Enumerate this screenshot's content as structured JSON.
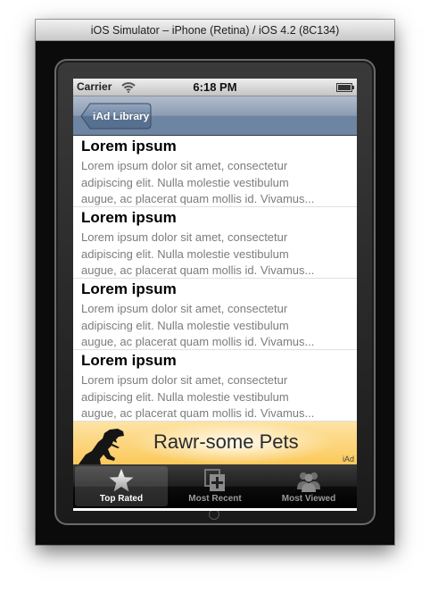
{
  "window": {
    "title": "iOS Simulator – iPhone (Retina) / iOS 4.2 (8C134)"
  },
  "status_bar": {
    "carrier": "Carrier",
    "time": "6:18 PM",
    "icons": [
      "wifi-icon",
      "battery-icon"
    ]
  },
  "nav_bar": {
    "back_label": "iAd Library"
  },
  "table": {
    "rows": [
      {
        "title": "Lorem ipsum",
        "body": "Lorem ipsum dolor sit amet, consectetur\nadipiscing elit. Nulla molestie vestibulum\naugue, ac placerat quam mollis id. Vivamus..."
      },
      {
        "title": "Lorem ipsum",
        "body": "Lorem ipsum dolor sit amet, consectetur\nadipiscing elit. Nulla molestie vestibulum\naugue, ac placerat quam mollis id. Vivamus..."
      },
      {
        "title": "Lorem ipsum",
        "body": "Lorem ipsum dolor sit amet, consectetur\nadipiscing elit. Nulla molestie vestibulum\naugue, ac placerat quam mollis id. Vivamus..."
      },
      {
        "title": "Lorem ipsum",
        "body": "Lorem ipsum dolor sit amet, consectetur\nadipiscing elit. Nulla molestie vestibulum\naugue, ac placerat quam mollis id. Vivamus..."
      }
    ]
  },
  "ad": {
    "text": "Rawr-some Pets",
    "badge": "iAd",
    "icon": "dinosaur-icon"
  },
  "tab_bar": {
    "tabs": [
      {
        "label": "Top Rated",
        "icon": "star-icon",
        "selected": true
      },
      {
        "label": "Most Recent",
        "icon": "most-recent-icon",
        "selected": false
      },
      {
        "label": "Most Viewed",
        "icon": "people-icon",
        "selected": false
      }
    ]
  },
  "colors": {
    "nav_bar": "#6d84a2",
    "ad_background": "#fbc95a",
    "tab_bar": "#000000"
  }
}
